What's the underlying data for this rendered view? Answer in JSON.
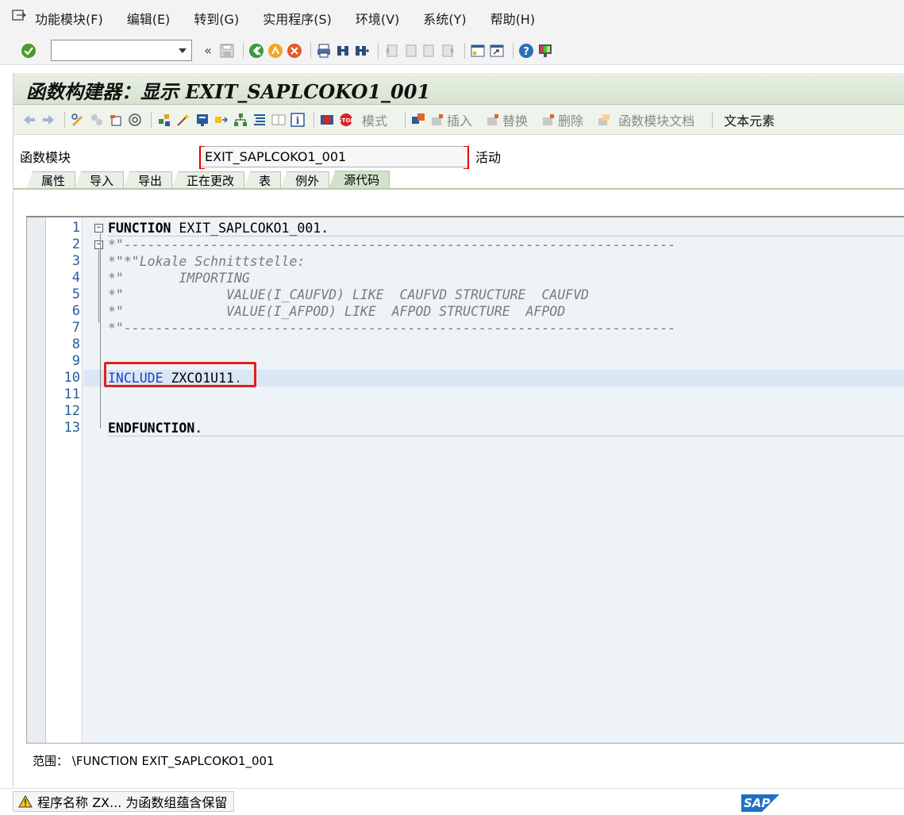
{
  "menubar": {
    "items": [
      "功能模块(F)",
      "编辑(E)",
      "转到(G)",
      "实用程序(S)",
      "环境(V)",
      "系统(Y)",
      "帮助(H)"
    ]
  },
  "systoolbar": {
    "command_value": ""
  },
  "window": {
    "title": "函数构建器：显示 EXIT_SAPLCOKO1_001"
  },
  "apptoolbar": {
    "mode_label": "模式",
    "insert_label": "插入",
    "replace_label": "替换",
    "delete_label": "删除",
    "fm_doc_label": "函数模块文档",
    "text_elements_label": "文本元素"
  },
  "function_module": {
    "label": "函数模块",
    "value": "EXIT_SAPLCOKO1_001",
    "status": "活动"
  },
  "tabs": [
    "属性",
    "导入",
    "导出",
    "正在更改",
    "表",
    "例外",
    "源代码"
  ],
  "active_tab": "源代码",
  "editor": {
    "line_numbers": [
      "1",
      "2",
      "3",
      "4",
      "5",
      "6",
      "7",
      "8",
      "9",
      "10",
      "11",
      "12",
      "13"
    ],
    "code": {
      "l1_kw": "FUNCTION",
      "l1_rest": " EXIT_SAPLCOKO1_001.",
      "l2": "*\"----------------------------------------------------------------------",
      "l3": "*\"*\"Lokale Schnittstelle:",
      "l4": "*\"       IMPORTING",
      "l5": "*\"             VALUE(I_CAUFVD) LIKE  CAUFVD STRUCTURE  CAUFVD",
      "l6": "*\"             VALUE(I_AFPOD) LIKE  AFPOD STRUCTURE  AFPOD",
      "l7": "*\"----------------------------------------------------------------------",
      "l10_kw": "INCLUDE",
      "l10_rest": " ZXCO1U11",
      "l10_dot": ".",
      "l13_kw": "ENDFUNCTION",
      "l13_dot": "."
    }
  },
  "scope": "范围： \\FUNCTION EXIT_SAPLCOKO1_001",
  "status_message": "程序名称 ZX... 为函数组蕴含保留",
  "sap_logo_text": "SAP",
  "colors": {
    "highlight_box": "#e0201b",
    "include_keyword": "#1f3fd1",
    "title_bg": "#d6e3cf"
  }
}
